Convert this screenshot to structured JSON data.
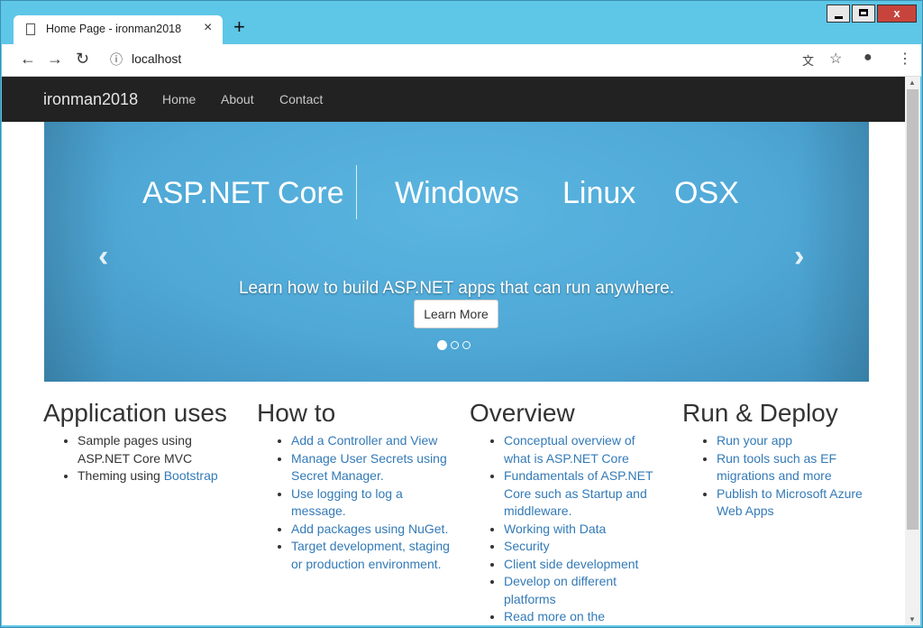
{
  "browser": {
    "tab_title": "Home Page - ironman2018",
    "tab_close": "×",
    "new_tab": "+",
    "url": "localhost",
    "window_close": "x"
  },
  "navbar": {
    "brand": "ironman2018",
    "links": [
      "Home",
      "About",
      "Contact"
    ]
  },
  "carousel": {
    "headline_main": "ASP.NET Core",
    "platforms": [
      "Windows",
      "Linux",
      "OSX"
    ],
    "caption": "Learn how to build ASP.NET apps that can run anywhere.",
    "button": "Learn More",
    "prev": "‹",
    "next": "›"
  },
  "columns": [
    {
      "title": "Application uses",
      "items": [
        {
          "text": "Sample pages using ASP.NET Core MVC"
        },
        {
          "text": "Theming using ",
          "link": "Bootstrap"
        }
      ]
    },
    {
      "title": "How to",
      "items": [
        {
          "link": "Add a Controller and View"
        },
        {
          "link": "Manage User Secrets using Secret Manager."
        },
        {
          "link": "Use logging to log a message."
        },
        {
          "link": "Add packages using NuGet."
        },
        {
          "link": "Target development, staging or production environment."
        }
      ]
    },
    {
      "title": "Overview",
      "items": [
        {
          "link": "Conceptual overview of what is ASP.NET Core"
        },
        {
          "link": "Fundamentals of ASP.NET Core such as Startup and middleware."
        },
        {
          "link": "Working with Data"
        },
        {
          "link": "Security"
        },
        {
          "link": "Client side development"
        },
        {
          "link": "Develop on different platforms"
        },
        {
          "link": "Read more on the"
        }
      ]
    },
    {
      "title": "Run & Deploy",
      "items": [
        {
          "link": "Run your app"
        },
        {
          "link": "Run tools such as EF migrations and more"
        },
        {
          "link": "Publish to Microsoft Azure Web Apps"
        }
      ]
    }
  ]
}
